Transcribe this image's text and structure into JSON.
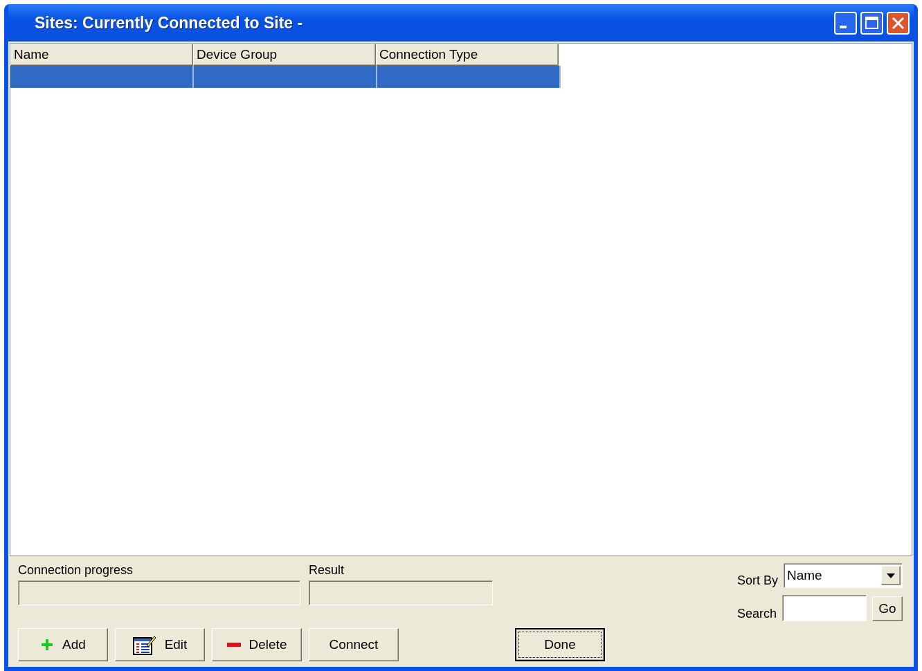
{
  "window": {
    "title": "Sites: Currently Connected to Site -"
  },
  "table": {
    "columns": [
      "Name",
      "Device Group",
      "Connection Type"
    ],
    "rows": [
      {
        "selected": true
      }
    ]
  },
  "progress": {
    "label": "Connection progress"
  },
  "result": {
    "label": "Result"
  },
  "buttons": [
    {
      "label": "Add",
      "kind": "add"
    },
    {
      "label": "Edit",
      "kind": "edit"
    },
    {
      "label": "Delete",
      "kind": "delete"
    },
    {
      "label": "Connect",
      "kind": "plain"
    }
  ],
  "done_button": {
    "label": "Done",
    "default": true
  },
  "sort": {
    "label": "Sort By",
    "value": "Name"
  },
  "search": {
    "label": "Search",
    "button": "Go"
  }
}
